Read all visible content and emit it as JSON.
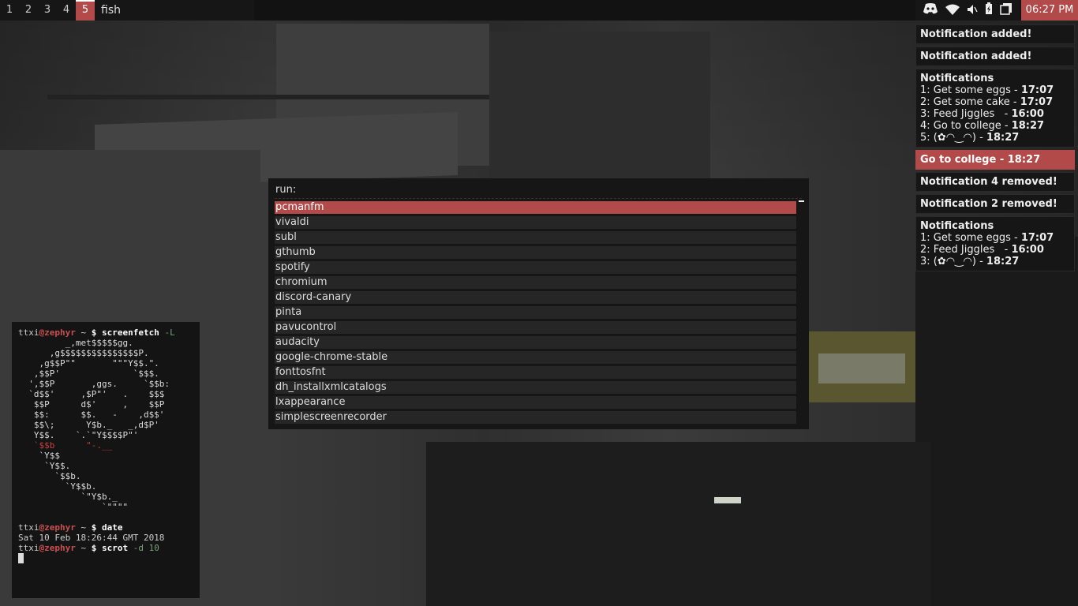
{
  "topbar": {
    "workspaces": [
      "1",
      "2",
      "3",
      "4",
      "5"
    ],
    "active_workspace": "5",
    "window_title": "fish",
    "tray_icons": [
      "discord-icon",
      "wifi-icon",
      "volume-icon",
      "battery-icon",
      "clipboard-icon"
    ],
    "clock": "06:27 PM"
  },
  "notifications": [
    {
      "type": "simple",
      "text": "Notification added!"
    },
    {
      "type": "simple",
      "text": "Notification added!"
    },
    {
      "type": "list",
      "head": "Notifications",
      "rows": [
        {
          "text": "1: Get some eggs - ",
          "time": "17:07"
        },
        {
          "text": "2: Get some cake - ",
          "time": "17:07"
        },
        {
          "text": "3: Feed Jiggles   - ",
          "time": "16:00"
        },
        {
          "text": "4: Go to college - ",
          "time": "18:27"
        },
        {
          "text": "5: (✿◠‿◠) - ",
          "time": "18:27"
        }
      ]
    },
    {
      "type": "highlight",
      "text": "Go to college - 18:27"
    },
    {
      "type": "simple",
      "text": "Notification 4 removed!"
    },
    {
      "type": "simple",
      "text": "Notification 2 removed!"
    },
    {
      "type": "list",
      "head": "Notifications",
      "rows": [
        {
          "text": "1: Get some eggs - ",
          "time": "17:07"
        },
        {
          "text": "2: Feed Jiggles   - ",
          "time": "16:00"
        },
        {
          "text": "3: (✿◠‿◠) - ",
          "time": "18:27"
        }
      ]
    }
  ],
  "run_dialog": {
    "prompt": "run:",
    "items": [
      "pcmanfm",
      "vivaldi",
      "subl",
      "gthumb",
      "spotify",
      "chromium",
      "discord-canary",
      "pinta",
      "pavucontrol",
      "audacity",
      "google-chrome-stable",
      "fonttosfnt",
      "dh_installxmlcatalogs",
      "lxappearance",
      "simplescreenrecorder"
    ],
    "selected": "pcmanfm"
  },
  "terminal": {
    "user": "ttxi",
    "host": "zephyr",
    "cwd": "~",
    "commands": [
      {
        "cmd": "screenfetch",
        "arg": "-L"
      },
      {
        "cmd": "date",
        "arg": ""
      },
      {
        "cmd": "scrot",
        "arg": "-d 10"
      }
    ],
    "date_output": "Sat 10 Feb 18:26:44 GMT 2018",
    "ascii_logo": [
      "         _,met$$$$$gg.",
      "      ,g$$$$$$$$$$$$$$$P.",
      "    ,g$$P\"\"       \"\"\"Y$$.\".",
      "   ,$$P'              `$$$.",
      "  ',$$P       ,ggs.     `$$b:",
      "  `d$$'     ,$P\"'   .    $$$",
      "   $$P      d$'     ,    $$P",
      "   $$:      $$.   -    ,d$$'",
      "   $$\\;      Y$b._   _,d$P'",
      "   Y$$.    `.`\"Y$$$$P\"'",
      "   `$$b      \"-.__",
      "    `Y$$",
      "     `Y$$.",
      "       `$$b.",
      "         `Y$$b.",
      "            `\"Y$b._",
      "                `\"\"\"\""
    ]
  }
}
